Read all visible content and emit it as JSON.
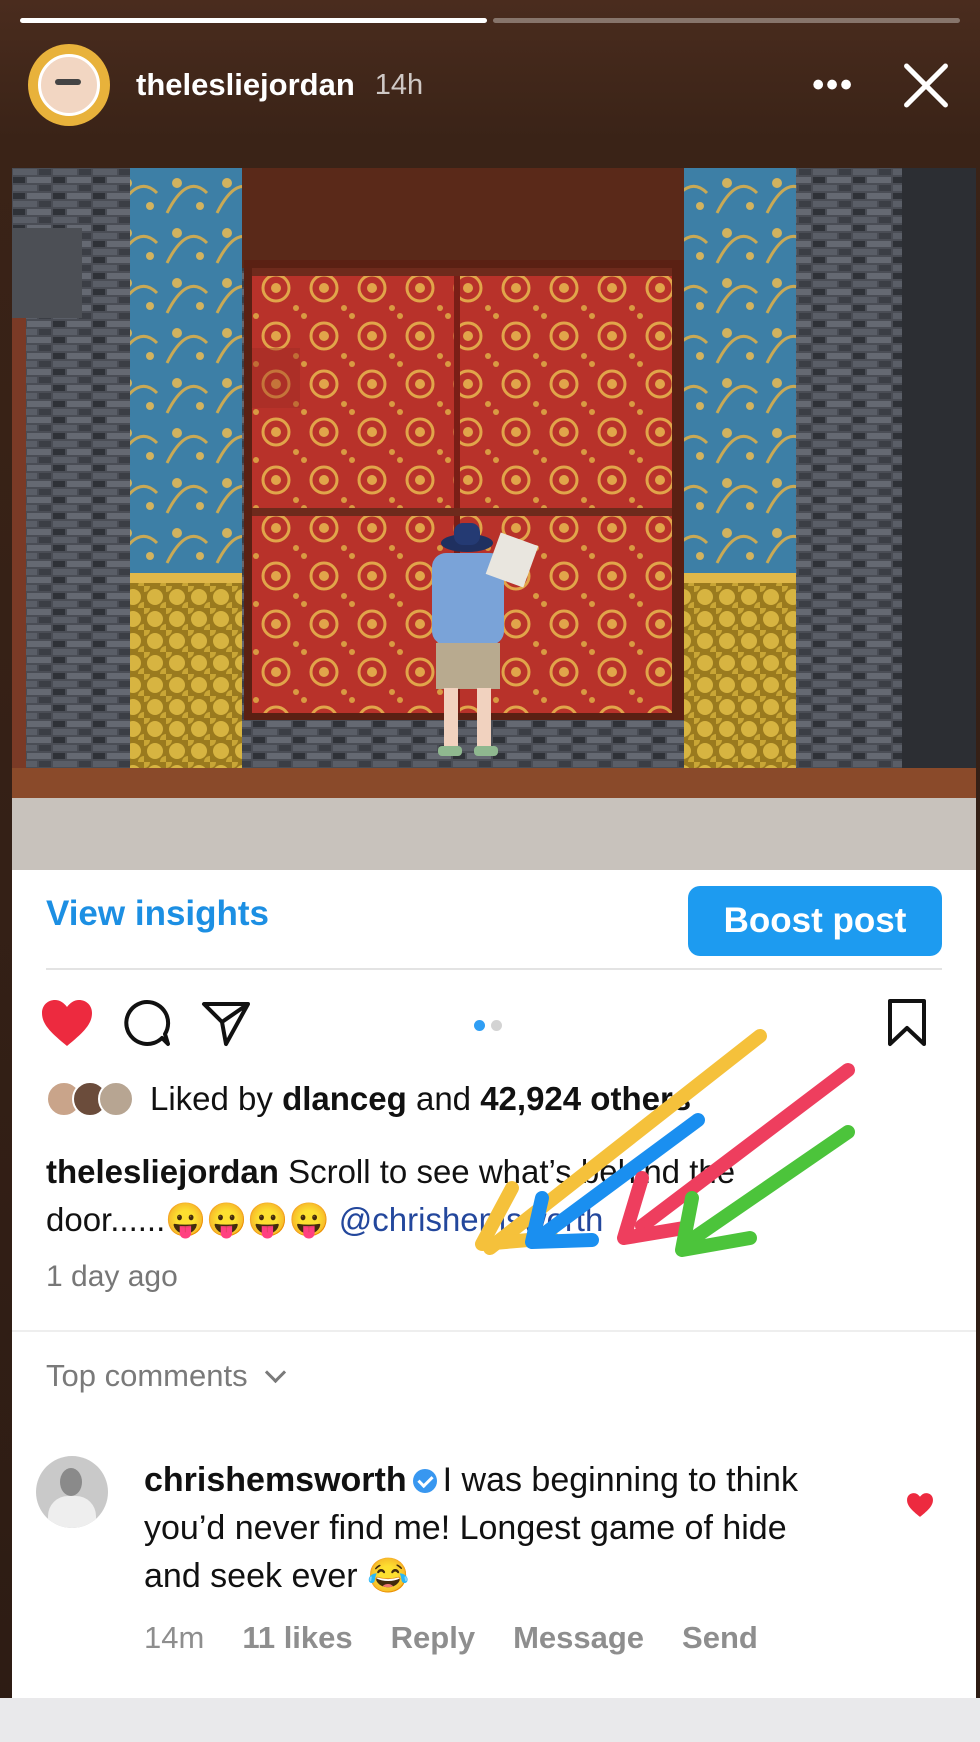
{
  "story": {
    "progress": {
      "segments": 2,
      "current_fill": 1.0,
      "active_index": 0
    },
    "username": "thelesliejordan",
    "time": "14h",
    "icons": {
      "more": "more-dots-icon",
      "close": "close-icon"
    }
  },
  "post": {
    "insights": {
      "view_label": "View insights",
      "boost_label": "Boost post"
    },
    "actions": {
      "like_icon": "heart-filled-icon",
      "comment_icon": "comment-icon",
      "share_icon": "send-icon",
      "save_icon": "bookmark-icon",
      "carousel_dots": 2,
      "carousel_active": 0
    },
    "likes": {
      "prefix": "Liked by",
      "user": "dlanceg",
      "conj": "and",
      "count": "42,924 others"
    },
    "caption": {
      "user": "thelesliejordan",
      "text_start": "Scroll to see what’s behind the",
      "text_line2": "door......😛😛😛😛",
      "mention": "@chrishemsworth"
    },
    "posted": "1 day ago",
    "comments_header": "Top comments",
    "top_comment": {
      "user": "chrishemsworth",
      "text": "I was beginning to think you’d never find me! Longest game of hide and seek ever 😂",
      "time": "14m",
      "likes": "11 likes",
      "reply": "Reply",
      "message": "Message",
      "send": "Send"
    },
    "colors": {
      "accent": "#1d9bf0",
      "link": "#1c8fe3",
      "heart": "#ed2a3f",
      "mention": "#23479c"
    },
    "annotation_arrow_colors": [
      "#f5c13b",
      "#1a8ff0",
      "#ee3e5e",
      "#4cc43b"
    ]
  }
}
